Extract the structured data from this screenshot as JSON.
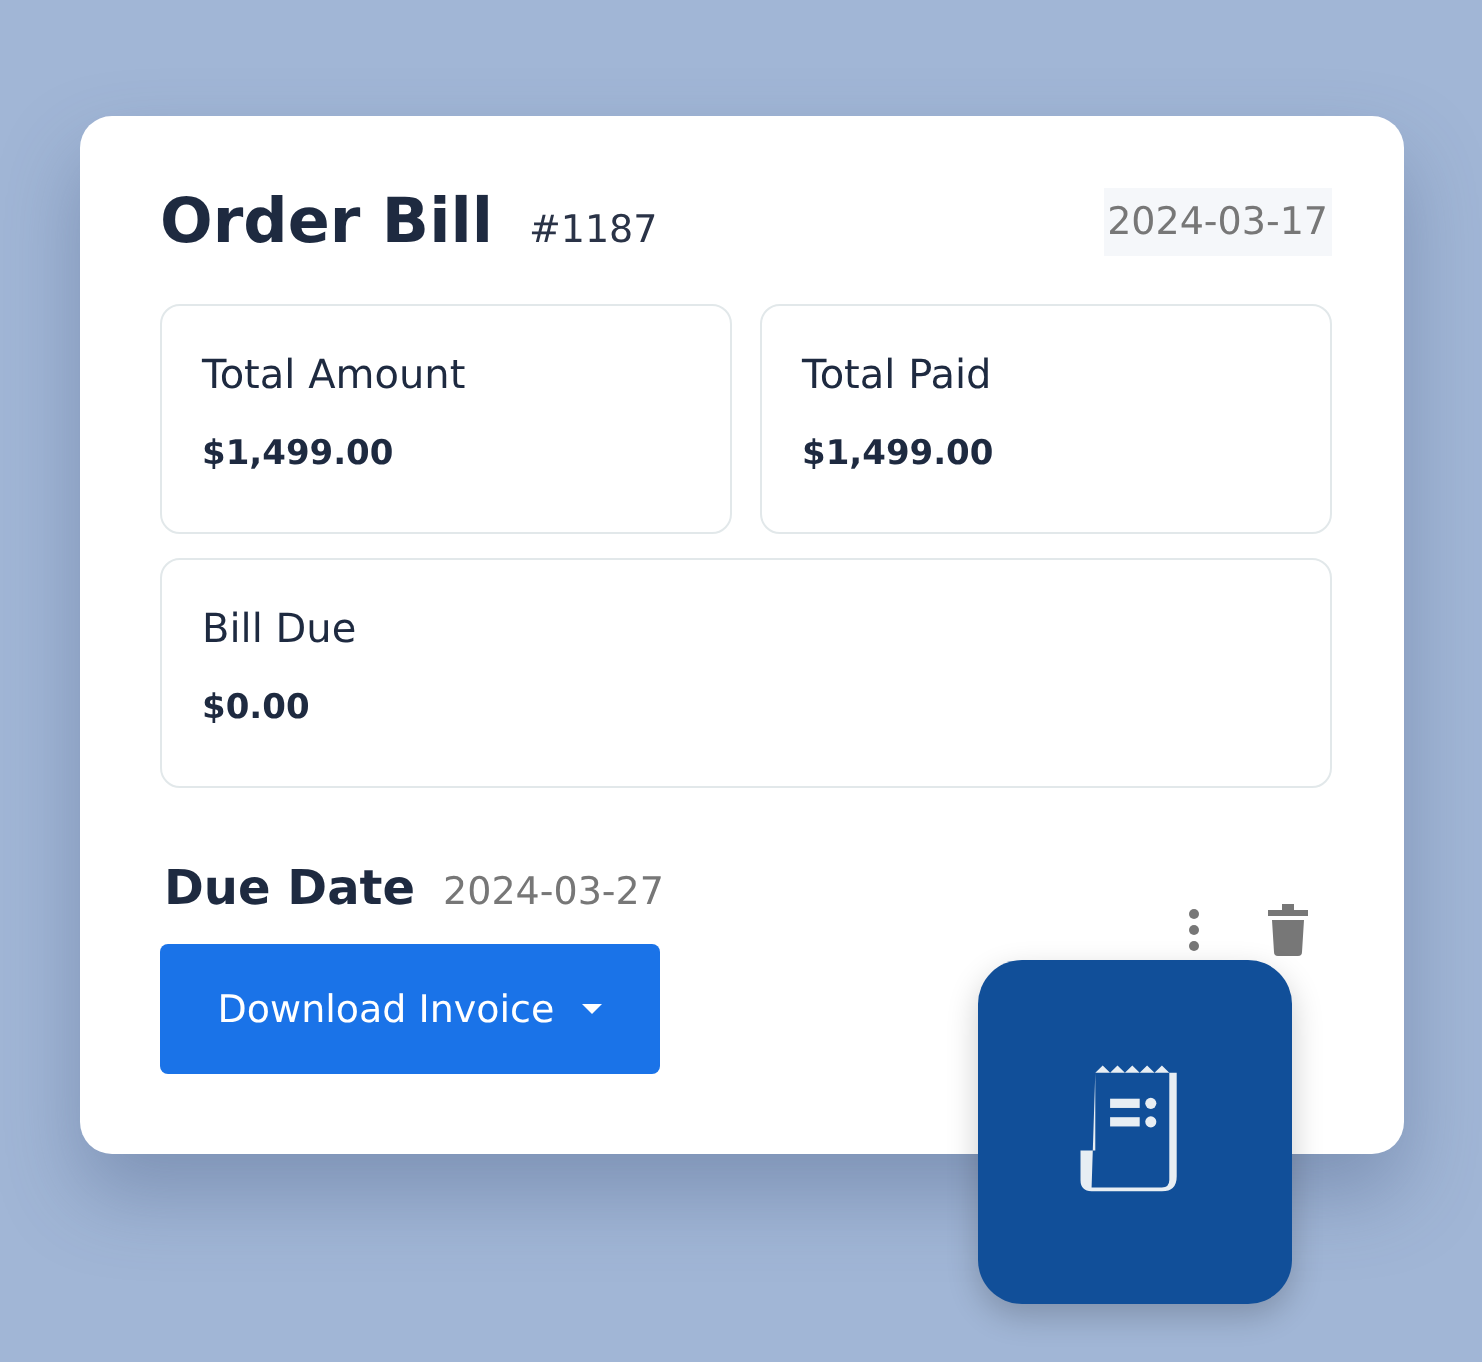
{
  "header": {
    "title": "Order Bill",
    "number": "#1187",
    "date": "2024-03-17"
  },
  "stats": [
    {
      "label": "Total Amount",
      "value": "$1,499.00"
    },
    {
      "label": "Total Paid",
      "value": "$1,499.00"
    },
    {
      "label": "Bill Due",
      "value": "$0.00"
    }
  ],
  "due": {
    "label": "Due Date",
    "date": "2024-03-27"
  },
  "download_button": {
    "label": "Download Invoice"
  }
}
